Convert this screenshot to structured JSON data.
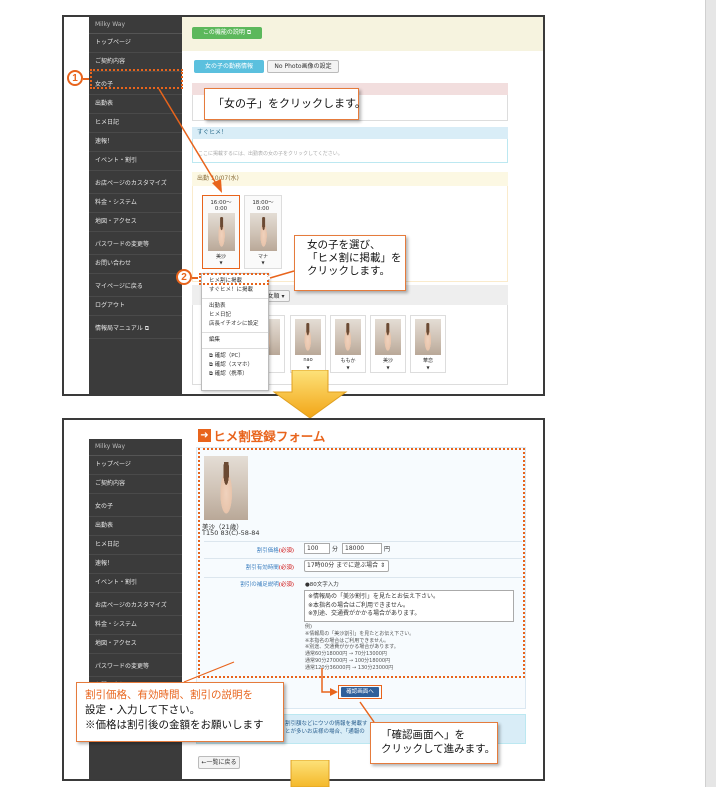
{
  "top": {
    "sidebar": {
      "brand": "Milky Way",
      "items": [
        "トップページ",
        "ご契約内容",
        "女の子",
        "出勤表",
        "ヒメ日記",
        "速報！",
        "イベント・割引",
        "お店ページのカスタマイズ",
        "料金・システム",
        "地図・アクセス",
        "パスワードの変更等",
        "お問い合わせ",
        "マイページに戻る",
        "ログアウト",
        "情報局マニュアル"
      ]
    },
    "feature_button": "この機能の説明",
    "tab_active": "女の子の勤務情報",
    "tab_inactive": "No Photo画像の設定",
    "callout1": "「女の子」をクリックします。",
    "sugu_hime": "すぐヒメ！",
    "sugu_desc": "ここに掲載するには、出勤表の女の子をクリックしてください。",
    "date_header": "出勤 10/07(水)",
    "shift1": {
      "time": "16:00～",
      "end": "0:00",
      "name": "美沙"
    },
    "shift2": {
      "time": "18:00～",
      "end": "0:00",
      "name": "マナ"
    },
    "callout2": [
      "女の子を選び、",
      "「ヒメ割に掲載」を",
      "クリックします。"
    ],
    "menu_items": [
      "ヒメ割に掲載",
      "すぐヒメ！に掲載",
      "出勤表",
      "ヒメ日記",
      "店長イチオシに設定",
      "編集",
      "確認（PC）",
      "確認（スマホ）",
      "確認（携帯）"
    ],
    "filter_label": "女順",
    "bottom_girls": [
      "ン",
      "nao",
      "ももか",
      "美沙",
      "華恋"
    ]
  },
  "bottom": {
    "title": "ヒメ割登録フォーム",
    "sidebar": {
      "brand": "Milky Way",
      "items": [
        "トップページ",
        "ご契約内容",
        "女の子",
        "出勤表",
        "ヒメ日記",
        "速報！",
        "イベント・割引",
        "お店ページのカスタマイズ",
        "料金・システム",
        "地図・アクセス",
        "パスワードの変更等",
        "お問い合わせ"
      ]
    },
    "profile_name": "美沙（21歳）",
    "profile_size": "T150 83(C)-58-84",
    "form": {
      "price_label": "割引価格",
      "price_minutes": "100",
      "price_unit_min": "分",
      "price_value": "18000",
      "price_unit_yen": "円",
      "time_label": "割引有効時間",
      "time_value": "17時00分 までに遊ぶ場合",
      "desc_label": "割引の補足説明",
      "required": "(必須)",
      "char_note": "●80文字入力",
      "desc_lines": [
        "※情報局の「美沙割引」を見たとお伝え下さい。",
        "※本指名の場合はご利用できません。",
        "※別途、交通費がかかる場合があります。"
      ],
      "example_head": "例)",
      "example_lines": [
        "※情報局の「美沙割引」を見たとお伝え下さい。",
        "※本指名の場合はご利用できません。",
        "※別途、交通費がかかる場合があります。",
        "通常60分18000円 → 70分13000円",
        "通常90分27000円 → 100分18000円",
        "通常120分36000円 → 130分23000円"
      ]
    },
    "confirm_button": "確認画面へ",
    "notice_lines": [
      "割引額などにウソの情報を掲載す",
      "とが多いお店様の場合、「通報の"
    ],
    "back_button": "一覧に戻る",
    "callout3": [
      "割引価格、有効時間、割引の説明を",
      "設定・入力して下さい。",
      "※価格は割引後の金額をお願いします"
    ],
    "callout4": [
      "「確認画面へ」を",
      "クリックして進みます。"
    ]
  },
  "colors": {
    "accent": "#e8641c",
    "sidebar": "#3b3b3b",
    "green": "#5cb85c",
    "blue": "#5bc0de"
  }
}
